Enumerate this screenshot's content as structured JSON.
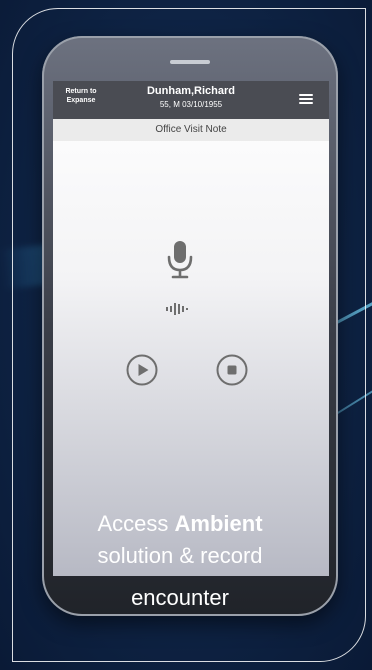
{
  "app_bar": {
    "return_label_line1": "Return to",
    "return_label_line2": "Expanse",
    "patient_name": "Dunham,Richard",
    "patient_info": "55, M 03/10/1955"
  },
  "note_title": "Office Visit Note",
  "caption": {
    "prefix": "Access ",
    "bold": "Ambient",
    "line2": "solution & record",
    "line3": "encounter"
  },
  "icons": [
    "microphone-icon",
    "audio-wave-icon",
    "play-icon",
    "stop-icon",
    "hamburger-menu-icon"
  ],
  "colors": {
    "app_bar": "#4a4c53",
    "background": "#0f2547",
    "icon_gray": "#6e6e6e",
    "caption_text": "#ffffff"
  }
}
